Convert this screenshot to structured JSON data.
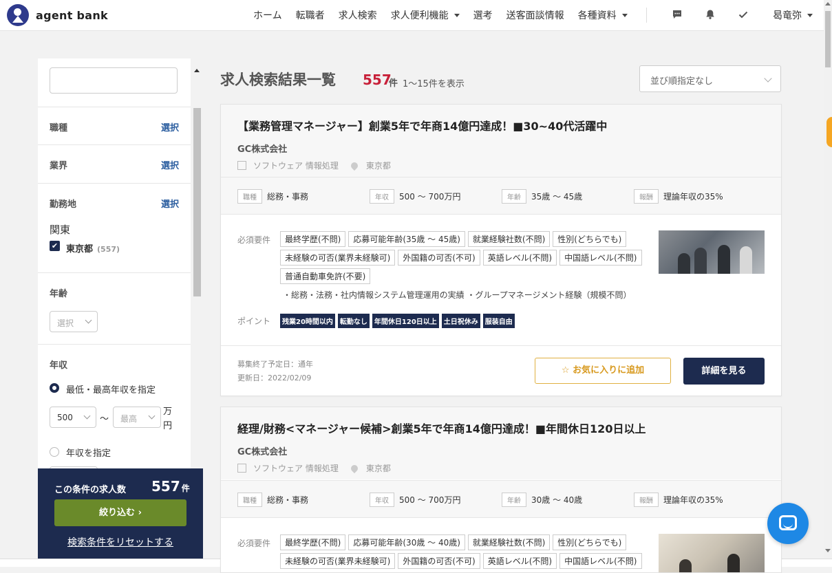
{
  "header": {
    "logo_text": "agent bank",
    "nav": [
      {
        "label": "ホーム",
        "caret": false
      },
      {
        "label": "転職者",
        "caret": false
      },
      {
        "label": "求人検索",
        "caret": false
      },
      {
        "label": "求人便利機能",
        "caret": true
      },
      {
        "label": "選考",
        "caret": false
      },
      {
        "label": "送客面談情報",
        "caret": false
      },
      {
        "label": "各種資料",
        "caret": true
      }
    ],
    "icons": [
      "chat-icon",
      "bell-icon",
      "check-icon"
    ],
    "user_name": "曷竜弥"
  },
  "sidebar": {
    "keyword_placeholder": "",
    "job_type": {
      "label": "職種",
      "select": "選択"
    },
    "industry": {
      "label": "業界",
      "select": "選択"
    },
    "location": {
      "label": "勤務地",
      "select": "選択",
      "region": "関東",
      "pref": "東京都",
      "pref_count": "(557)"
    },
    "age": {
      "label": "年齢",
      "placeholder": "選択"
    },
    "salary": {
      "label": "年収",
      "option1": "最低・最高年収を指定",
      "min_value": "500",
      "separator": "〜",
      "max_placeholder": "最高",
      "unit": "万円",
      "option2": "年収を指定"
    },
    "filter": {
      "count_label": "この条件の求人数",
      "count": "557",
      "count_unit": "件",
      "button": "絞り込む",
      "reset": "検索条件をリセットする"
    }
  },
  "main": {
    "title": "求人検索結果一覧",
    "count": "557",
    "count_unit": "件",
    "range": "1〜15件を表示",
    "sort": "並び順指定なし"
  },
  "jobs": [
    {
      "title": "【業務管理マネージャー】創業5年で年商14億円達成！■30~40代活躍中",
      "company": "GC株式会社",
      "industry": "ソフトウェア 情報処理",
      "location": "東京都",
      "specs": [
        {
          "tag": "職種",
          "value": "総務・事務"
        },
        {
          "tag": "年収",
          "value": "500 〜 700万円"
        },
        {
          "tag": "年齢",
          "value": "35歳 〜 45歳"
        },
        {
          "tag": "報酬",
          "value": "理論年収の35%"
        }
      ],
      "requirements_label": "必須要件",
      "requirements": [
        "最終学歴(不問)",
        "応募可能年齢(35歳 〜 45歳)",
        "就業経験社数(不問)",
        "性別(どちらでも)",
        "未経験の可否(業界未経験可)",
        "外国籍の可否(不可)",
        "英語レベル(不問)",
        "中国語レベル(不問)",
        "普通自動車免許(不要)"
      ],
      "requirements_text": "・総務・法務・社内情報システム管理運用の実績 ・グループマネージメント経験（規模不問）",
      "points_label": "ポイント",
      "points": [
        "残業20時間以内",
        "転勤なし",
        "年間休日120日以上",
        "土日祝休み",
        "服装自由"
      ],
      "deadline": "募集終了予定日：通年",
      "updated": "更新日：2022/02/09",
      "fav_label": "お気に入りに追加",
      "detail_label": "詳細を見る"
    },
    {
      "title": "経理/財務<マネージャー候補>創業5年で年商14億円達成！■年間休日120日以上",
      "company": "GC株式会社",
      "industry": "ソフトウェア 情報処理",
      "location": "東京都",
      "specs": [
        {
          "tag": "職種",
          "value": "総務・事務"
        },
        {
          "tag": "年収",
          "value": "500 〜 700万円"
        },
        {
          "tag": "年齢",
          "value": "30歳 〜 40歳"
        },
        {
          "tag": "報酬",
          "value": "理論年収の35%"
        }
      ],
      "requirements_label": "必須要件",
      "requirements": [
        "最終学歴(不問)",
        "応募可能年齢(30歳 〜 40歳)",
        "就業経験社数(不問)",
        "性別(どちらでも)",
        "未経験の可否(業界未経験可)",
        "外国籍の可否(不可)",
        "英語レベル(不問)",
        "中国語レベル(不問)"
      ]
    }
  ],
  "colors": {
    "navy": "#1d2b4f",
    "accent_red": "#c8213a",
    "link_blue": "#2a5d9f",
    "green": "#6a8a2a",
    "fav_gold": "#d89a20"
  }
}
